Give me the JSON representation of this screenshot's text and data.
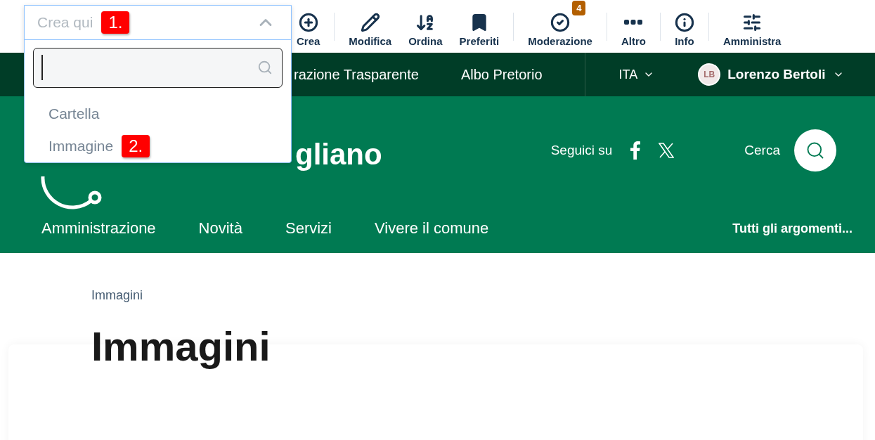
{
  "create_menu": {
    "placeholder": "Crea qui",
    "expanded": true,
    "step": "1.",
    "options": [
      {
        "label": "Cartella"
      },
      {
        "label": "Immagine",
        "step": "2."
      }
    ]
  },
  "toolbar": [
    {
      "kind": "plus",
      "label": "Crea",
      "separator_after": true
    },
    {
      "kind": "pencil",
      "label": "Modifica",
      "separator_after": false
    },
    {
      "kind": "sort",
      "label": "Ordina",
      "separator_after": false
    },
    {
      "kind": "bookmark",
      "label": "Preferiti",
      "separator_after": true
    },
    {
      "kind": "check",
      "label": "Moderazione",
      "badge": "4",
      "separator_after": true
    },
    {
      "kind": "dots",
      "label": "Altro",
      "separator_after": true
    },
    {
      "kind": "info",
      "label": "Info",
      "separator_after": true
    },
    {
      "kind": "sliders",
      "label": "Amministra",
      "separator_after": false
    }
  ],
  "top_bar": {
    "links": [
      "razione Trasparente",
      "Albo Pretorio"
    ],
    "language": "ITA",
    "user": {
      "initials": "LB",
      "name": "Lorenzo Bertoli"
    }
  },
  "brand": {
    "title": "gliano",
    "follow_label": "Seguici su",
    "search_label": "Cerca"
  },
  "nav": {
    "items": [
      "Amministrazione",
      "Novità",
      "Servizi",
      "Vivere il comune"
    ],
    "all_topics": "Tutti gli argomenti..."
  },
  "breadcrumb": "Immagini",
  "page_title": "Immagini"
}
